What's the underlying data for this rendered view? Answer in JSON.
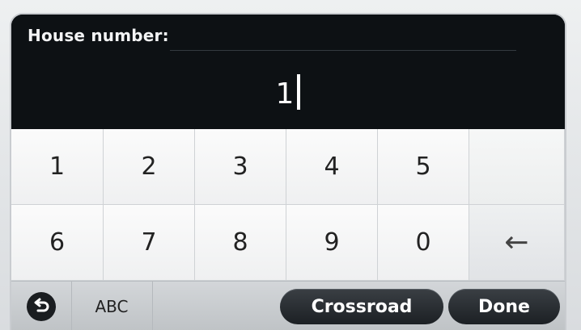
{
  "header": {
    "label": "House number:",
    "value": "1"
  },
  "keypad": {
    "row1": [
      "1",
      "2",
      "3",
      "4",
      "5"
    ],
    "row2": [
      "6",
      "7",
      "8",
      "9",
      "0"
    ],
    "backspace_glyph": "←"
  },
  "bottom": {
    "abc_label": "ABC",
    "crossroad_label": "Crossroad",
    "done_label": "Done"
  },
  "icons": {
    "backspace": "backspace-arrow-icon",
    "undo": "undo-icon"
  }
}
